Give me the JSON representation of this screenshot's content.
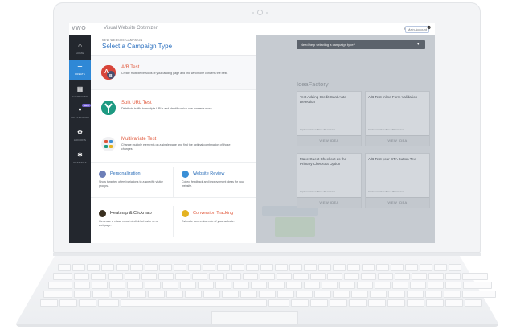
{
  "topbar": {
    "logo": "VWO",
    "title": "Visual Website Optimizer",
    "account_label": "Main Account"
  },
  "sidebar": {
    "items": [
      {
        "label": "HOME",
        "icon": "home-icon",
        "glyph": "⌂",
        "active": false
      },
      {
        "label": "CREATE",
        "icon": "plus-icon",
        "glyph": "+",
        "active": true
      },
      {
        "label": "CAMPAIGNS",
        "icon": "grid-icon",
        "glyph": "▦",
        "active": false
      },
      {
        "label": "IDEAFACTORY",
        "icon": "bulb-icon",
        "glyph": "●",
        "active": false,
        "badge": "NEW"
      },
      {
        "label": "ADD-ONS",
        "icon": "puzzle-icon",
        "glyph": "✿",
        "active": false
      },
      {
        "label": "SETTINGS",
        "icon": "gear-icon",
        "glyph": "✱",
        "active": false
      }
    ]
  },
  "panel": {
    "small_title": "NEW WEBSITE CAMPAIGN",
    "title": "Select a Campaign Type",
    "campaigns": [
      {
        "title": "A/B Test",
        "desc": "Create multiple versions of your landing page and find which one converts the best.",
        "icon": "ab-test-icon",
        "color": "#d8453a"
      },
      {
        "title": "Split URL Test",
        "desc": "Distribute traffic to multiple URLs and identify which one converts more.",
        "icon": "split-url-icon",
        "color": "#1e9a82"
      },
      {
        "title": "Multivariate Test",
        "desc": "Change multiple elements on a single page and find the optimal combination of those changes.",
        "icon": "multivariate-icon",
        "color": "#f1f1f3"
      }
    ],
    "tools": [
      {
        "title": "Personalization",
        "desc": "Show targeted offers/variations to a specific visitor groups.",
        "icon": "personalization-icon",
        "color": "#6d7fb8",
        "style": "blue"
      },
      {
        "title": "Website Review",
        "desc": "Collect feedback and improvement ideas for your website.",
        "icon": "review-icon",
        "color": "#3a8fd6",
        "style": "blue"
      },
      {
        "title": "Heatmap & Clickmap",
        "desc": "Generate a visual report of click behavior on a webpage.",
        "icon": "heatmap-icon",
        "color": "#3a3020",
        "style": "dark"
      },
      {
        "title": "Conversion Tracking",
        "desc": "Estimate conversion rate of your website.",
        "icon": "tracking-icon",
        "color": "#e4b322",
        "style": "orange"
      }
    ]
  },
  "overlay": {
    "help_text": "Need help selecting a campaign type?",
    "idea_title": "IdeaFactory",
    "ideas": [
      {
        "title": "Test Adding Credit Card Auto-Detection",
        "meta": "Implementation Time: 30 minutes",
        "button": "VIEW IDEA"
      },
      {
        "title": "A/B Test Inline Form Validation",
        "meta": "Implementation Time: 30 minutes",
        "button": "VIEW IDEA"
      },
      {
        "title": "Make Guest Checkout as the Primary Checkout Option",
        "meta": "Implementation Time: 30 minutes",
        "button": "VIEW IDEA"
      },
      {
        "title": "A/B Test your CTA Button Text",
        "meta": "Implementation Time: 15 minutes",
        "button": "VIEW IDEA"
      }
    ]
  }
}
